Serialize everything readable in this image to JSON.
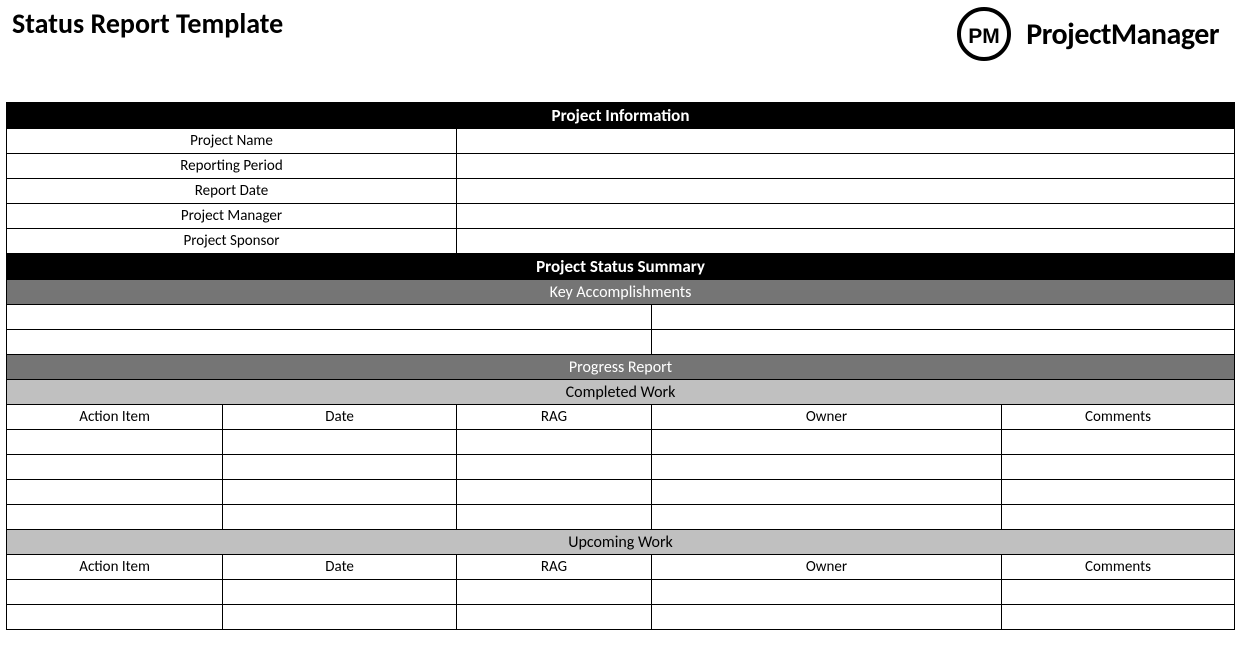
{
  "title": "Status Report Template",
  "brand": "ProjectManager",
  "sections": {
    "project_info": "Project Information",
    "status_summary": "Project Status Summary",
    "key_accomplishments": "Key Accomplishments",
    "progress_report": "Progress Report",
    "completed_work": "Completed Work",
    "upcoming_work": "Upcoming Work"
  },
  "info_fields": [
    "Project Name",
    "Reporting Period",
    "Report Date",
    "Project Manager",
    "Project Sponsor"
  ],
  "columns": {
    "action_item": "Action Item",
    "date": "Date",
    "rag": "RAG",
    "owner": "Owner",
    "comments": "Comments"
  }
}
